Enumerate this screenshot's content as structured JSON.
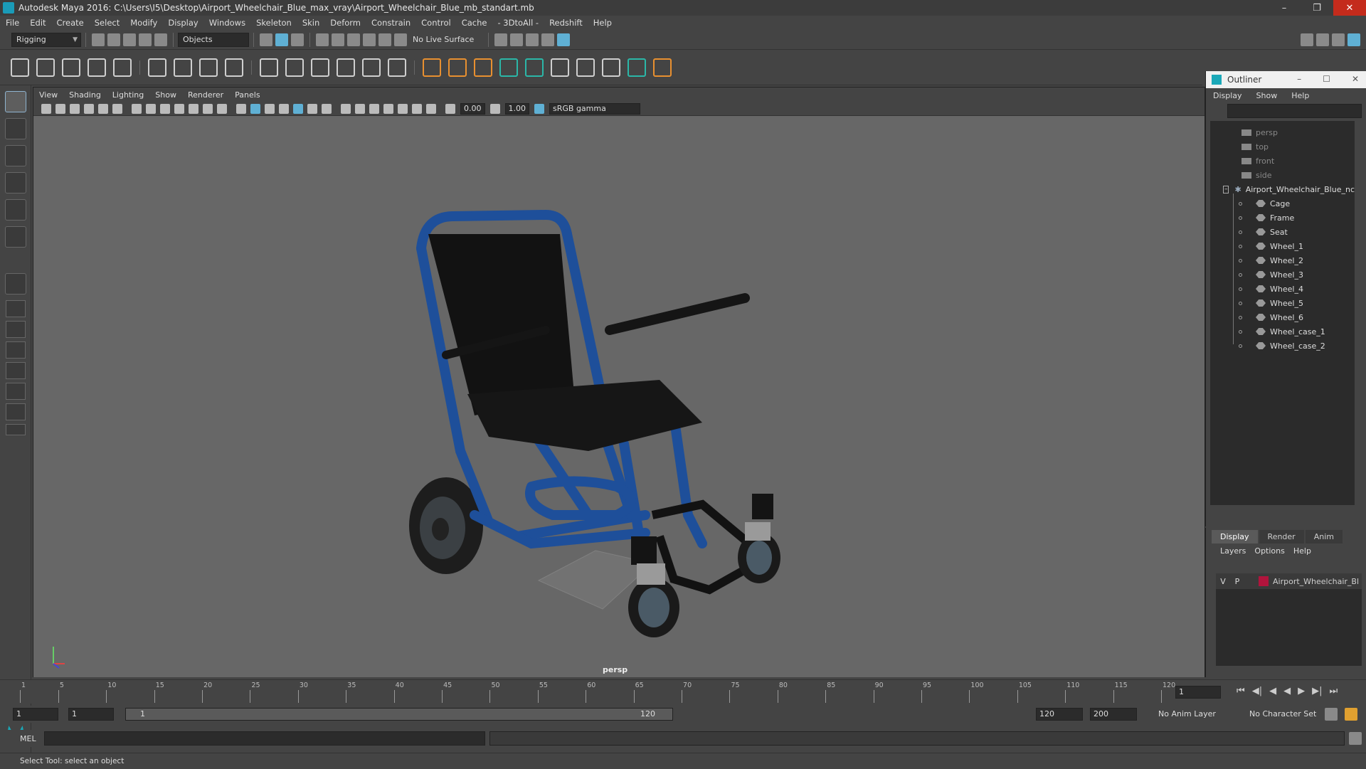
{
  "window": {
    "title": "Autodesk Maya 2016: C:\\Users\\I5\\Desktop\\Airport_Wheelchair_Blue_max_vray\\Airport_Wheelchair_Blue_mb_standart.mb"
  },
  "menu": [
    "File",
    "Edit",
    "Create",
    "Select",
    "Modify",
    "Display",
    "Windows",
    "Skeleton",
    "Skin",
    "Deform",
    "Constrain",
    "Control",
    "Cache",
    "- 3DtoAll -",
    "Redshift",
    "Help"
  ],
  "status": {
    "mode": "Rigging",
    "objects_label": "Objects",
    "live_surface": "No Live Surface"
  },
  "viewport": {
    "menu": [
      "View",
      "Shading",
      "Lighting",
      "Show",
      "Renderer",
      "Panels"
    ],
    "exposure": "0.00",
    "gamma": "1.00",
    "color_space": "sRGB gamma",
    "camera_label": "persp"
  },
  "outliner": {
    "title": "Outliner",
    "menu": [
      "Display",
      "Show",
      "Help"
    ],
    "cameras": [
      "persp",
      "top",
      "front",
      "side"
    ],
    "group": "Airport_Wheelchair_Blue_nc",
    "children": [
      "Cage",
      "Frame",
      "Seat",
      "Wheel_1",
      "Wheel_2",
      "Wheel_3",
      "Wheel_4",
      "Wheel_5",
      "Wheel_6",
      "Wheel_case_1",
      "Wheel_case_2"
    ]
  },
  "layers": {
    "tabs": [
      "Display",
      "Render",
      "Anim"
    ],
    "menu": [
      "Layers",
      "Options",
      "Help"
    ],
    "row": {
      "v": "V",
      "p": "P",
      "name": "Airport_Wheelchair_Bl",
      "color": "#b0143c"
    }
  },
  "timeline": {
    "ticks": [
      "1",
      "5",
      "10",
      "15",
      "20",
      "25",
      "30",
      "35",
      "40",
      "45",
      "50",
      "55",
      "60",
      "65",
      "70",
      "75",
      "80",
      "85",
      "90",
      "95",
      "100",
      "105",
      "110",
      "115",
      "120"
    ],
    "current_frame": "1"
  },
  "range": {
    "start": "1",
    "playback_start": "1",
    "slider_start": "1",
    "slider_end": "120",
    "end": "120",
    "anim_end": "200",
    "anim_layer": "No Anim Layer",
    "character_set": "No Character Set"
  },
  "command": {
    "label": "MEL"
  },
  "help_line": "Select Tool: select an object"
}
